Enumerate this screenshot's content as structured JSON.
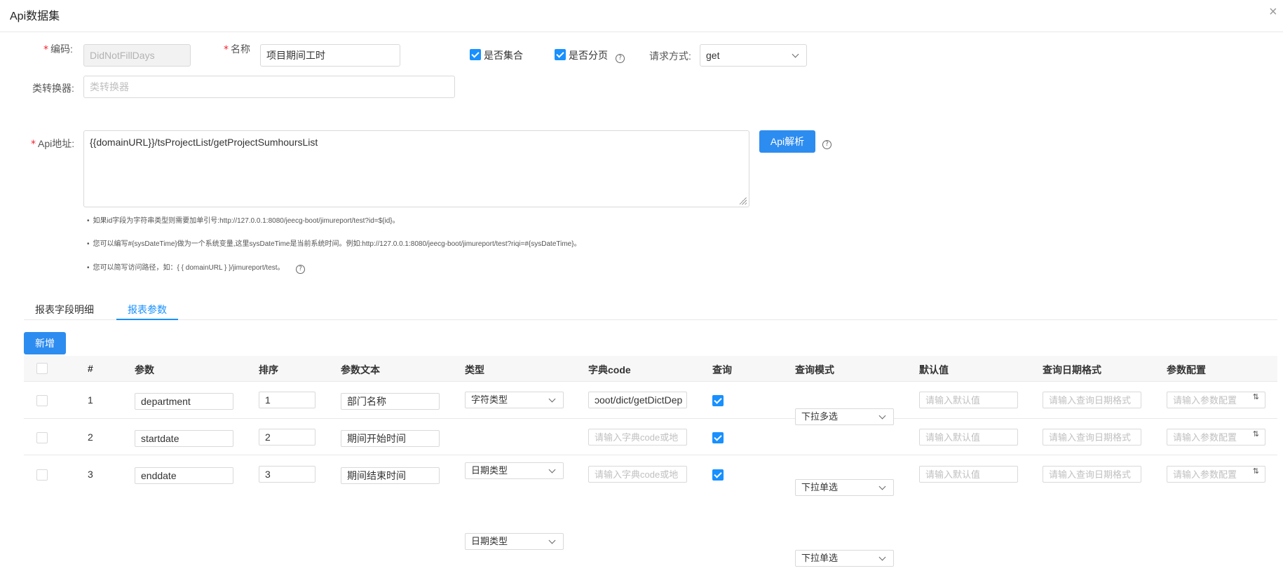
{
  "modal": {
    "title": "Api数据集",
    "close_glyph": "×"
  },
  "form": {
    "code": {
      "label": "编码:",
      "value": "DidNotFillDays"
    },
    "name": {
      "label": "名称",
      "value": "项目期间工时"
    },
    "is_collection": {
      "label": "是否集合",
      "checked": true
    },
    "is_paged": {
      "label": "是否分页",
      "checked": true
    },
    "request_method": {
      "label": "请求方式:",
      "value": "get"
    },
    "converter": {
      "label": "类转换器:",
      "placeholder": "类转换器"
    },
    "api_url": {
      "label": "Api地址:",
      "value": "{{domainURL}}/tsProjectList/getProjectSumhoursList"
    },
    "parse_button": "Api解析",
    "hints": [
      "如果id字段为字符串类型则需要加单引号:http://127.0.0.1:8080/jeecg-boot/jimureport/test?id=${id}。",
      "您可以编写#{sysDateTime}做为一个系统变量,这里sysDateTime是当前系统时间。例如:http://127.0.0.1:8080/jeecg-boot/jimureport/test?riqi=#{sysDateTime}。",
      "您可以简写访问路径，如：{ { domainURL } }/jimureport/test。"
    ]
  },
  "tabs": [
    {
      "label": "报表字段明细",
      "active": false
    },
    {
      "label": "报表参数",
      "active": true
    }
  ],
  "table": {
    "add_button": "新增",
    "columns": [
      "#",
      "参数",
      "排序",
      "参数文本",
      "类型",
      "字典code",
      "查询",
      "查询模式",
      "默认值",
      "查询日期格式",
      "参数配置"
    ],
    "placeholders": {
      "dict": "请输入字典code或地",
      "default": "请输入默认值",
      "date_format": "请输入查询日期格式",
      "config": "请输入参数配置"
    },
    "rows": [
      {
        "num": "1",
        "param": "department",
        "order": "1",
        "text": "部门名称",
        "type": "字符类型",
        "dict": "ɔoot/dict/getDictDep",
        "query": true,
        "mode": "下拉多选"
      },
      {
        "num": "2",
        "param": "startdate",
        "order": "2",
        "text": "期间开始时间",
        "type": "日期类型",
        "dict": "",
        "query": true,
        "mode": "下拉单选"
      },
      {
        "num": "3",
        "param": "enddate",
        "order": "3",
        "text": "期间结束时间",
        "type": "日期类型",
        "dict": "",
        "query": true,
        "mode": "下拉单选"
      }
    ]
  },
  "colors": {
    "primary": "#1890ff",
    "button": "#2d8cf0",
    "required": "#f5222d"
  }
}
